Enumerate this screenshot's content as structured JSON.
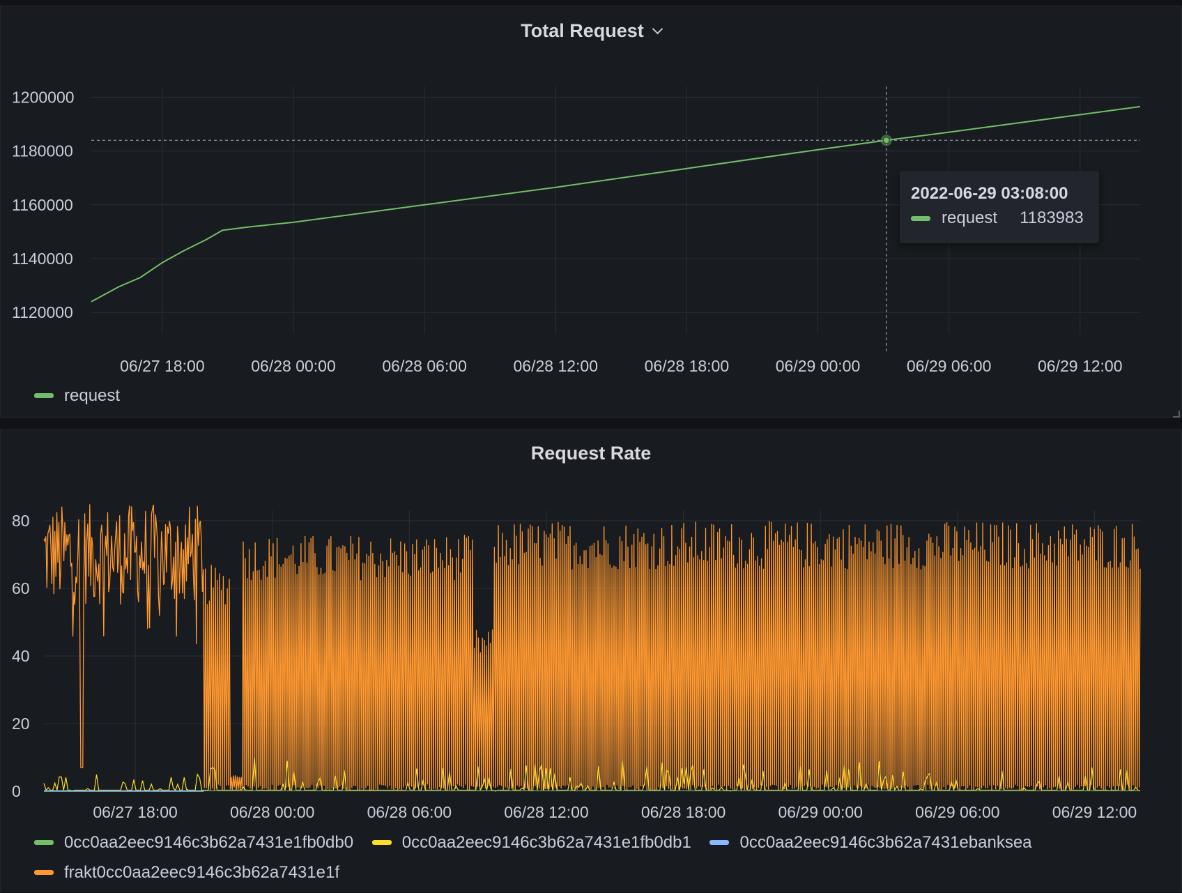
{
  "colors": {
    "background": "#181b1f",
    "grid": "#2c2f36",
    "text": "#ccccdc",
    "green": "#73bf69",
    "yellow": "#fade2a",
    "blue": "#8ab8ff",
    "orange": "#ff9830"
  },
  "panels": {
    "total_request": {
      "title": "Total Request",
      "menu_icon": "chevron-down-icon"
    },
    "request_rate": {
      "title": "Request Rate"
    }
  },
  "tooltip": {
    "time": "2022-06-29 03:08:00",
    "series": "request",
    "value": "1183983"
  },
  "chart_data": [
    {
      "type": "line",
      "title": "Total Request",
      "x_ticks": [
        "06/27 18:00",
        "06/28 00:00",
        "06/28 06:00",
        "06/28 12:00",
        "06/28 18:00",
        "06/29 00:00",
        "06/29 06:00",
        "06/29 12:00"
      ],
      "y_ticks": [
        "1120000",
        "1140000",
        "1160000",
        "1180000",
        "1200000"
      ],
      "xlim": [
        "2022-06-27 14:45",
        "2022-06-29 14:45"
      ],
      "ylim": [
        1112000,
        1204000
      ],
      "grid": true,
      "legend_placement": "bottom-left",
      "series": [
        {
          "name": "request",
          "color": "#73bf69",
          "points": [
            [
              "2022-06-27 14:45",
              1124000
            ],
            [
              "2022-06-27 16:00",
              1129500
            ],
            [
              "2022-06-27 17:00",
              1133000
            ],
            [
              "2022-06-27 18:00",
              1138500
            ],
            [
              "2022-06-27 19:00",
              1143000
            ],
            [
              "2022-06-27 20:00",
              1147000
            ],
            [
              "2022-06-27 20:45",
              1150500
            ],
            [
              "2022-06-27 22:00",
              1151800
            ],
            [
              "2022-06-28 00:00",
              1153500
            ],
            [
              "2022-06-28 06:00",
              1160000
            ],
            [
              "2022-06-28 12:00",
              1166500
            ],
            [
              "2022-06-28 18:00",
              1173500
            ],
            [
              "2022-06-29 00:00",
              1180500
            ],
            [
              "2022-06-29 03:08",
              1183983
            ],
            [
              "2022-06-29 06:00",
              1187000
            ],
            [
              "2022-06-29 12:00",
              1193500
            ],
            [
              "2022-06-29 14:45",
              1196500
            ]
          ]
        }
      ],
      "hover": {
        "x": "2022-06-29 03:08",
        "y": 1183983
      }
    },
    {
      "type": "line",
      "title": "Request Rate",
      "x_ticks": [
        "06/27 18:00",
        "06/28 00:00",
        "06/28 06:00",
        "06/28 12:00",
        "06/28 18:00",
        "06/29 00:00",
        "06/29 06:00",
        "06/29 12:00"
      ],
      "y_ticks": [
        "0",
        "20",
        "40",
        "60",
        "80"
      ],
      "xlim": [
        "2022-06-27 14:00",
        "2022-06-29 14:00"
      ],
      "ylim": [
        0,
        80
      ],
      "grid": true,
      "legend_placement": "bottom-left",
      "series": [
        {
          "name": "0cc0aa2eec9146c3b62a7431e1fb0db0",
          "color": "#73bf69",
          "description": "near zero throughout"
        },
        {
          "name": "0cc0aa2eec9146c3b62a7431e1fb0db1",
          "color": "#fade2a",
          "description": "small spikes 0-10"
        },
        {
          "name": "0cc0aa2eec9146c3b62a7431ebanksea",
          "color": "#8ab8ff",
          "description": "near zero throughout"
        },
        {
          "name": "frakt0cc0aa2eec9146c3b62a7431e1f",
          "color": "#ff9830",
          "description": "dense spikes; continuous 55-85 until ~06/27 21:00, then periodic spikes oscillating 0 to 55-80",
          "segments": [
            {
              "from": "2022-06-27 14:00",
              "to": "2022-06-27 21:00",
              "min": 55,
              "max": 85,
              "dips": [
                [
                  "2022-06-27 15:40",
                  7
                ]
              ]
            },
            {
              "from": "2022-06-27 21:00",
              "to": "2022-06-27 22:10",
              "min": 0,
              "max": 67
            },
            {
              "from": "2022-06-27 22:10",
              "to": "2022-06-27 22:40",
              "min": 0,
              "max": 5
            },
            {
              "from": "2022-06-27 22:40",
              "to": "2022-06-28 08:50",
              "min": 0,
              "max": 76
            },
            {
              "from": "2022-06-28 08:50",
              "to": "2022-06-28 09:40",
              "min": 0,
              "max": 48
            },
            {
              "from": "2022-06-28 09:40",
              "to": "2022-06-29 14:00",
              "min": 0,
              "max": 80
            }
          ]
        }
      ]
    }
  ]
}
